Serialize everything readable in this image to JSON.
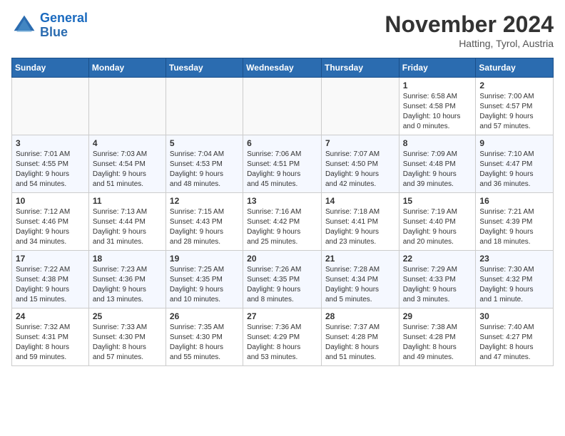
{
  "logo": {
    "text_general": "General",
    "text_blue": "Blue"
  },
  "title": "November 2024",
  "location": "Hatting, Tyrol, Austria",
  "days_of_week": [
    "Sunday",
    "Monday",
    "Tuesday",
    "Wednesday",
    "Thursday",
    "Friday",
    "Saturday"
  ],
  "weeks": [
    [
      {
        "day": "",
        "info": ""
      },
      {
        "day": "",
        "info": ""
      },
      {
        "day": "",
        "info": ""
      },
      {
        "day": "",
        "info": ""
      },
      {
        "day": "",
        "info": ""
      },
      {
        "day": "1",
        "info": "Sunrise: 6:58 AM\nSunset: 4:58 PM\nDaylight: 10 hours\nand 0 minutes."
      },
      {
        "day": "2",
        "info": "Sunrise: 7:00 AM\nSunset: 4:57 PM\nDaylight: 9 hours\nand 57 minutes."
      }
    ],
    [
      {
        "day": "3",
        "info": "Sunrise: 7:01 AM\nSunset: 4:55 PM\nDaylight: 9 hours\nand 54 minutes."
      },
      {
        "day": "4",
        "info": "Sunrise: 7:03 AM\nSunset: 4:54 PM\nDaylight: 9 hours\nand 51 minutes."
      },
      {
        "day": "5",
        "info": "Sunrise: 7:04 AM\nSunset: 4:53 PM\nDaylight: 9 hours\nand 48 minutes."
      },
      {
        "day": "6",
        "info": "Sunrise: 7:06 AM\nSunset: 4:51 PM\nDaylight: 9 hours\nand 45 minutes."
      },
      {
        "day": "7",
        "info": "Sunrise: 7:07 AM\nSunset: 4:50 PM\nDaylight: 9 hours\nand 42 minutes."
      },
      {
        "day": "8",
        "info": "Sunrise: 7:09 AM\nSunset: 4:48 PM\nDaylight: 9 hours\nand 39 minutes."
      },
      {
        "day": "9",
        "info": "Sunrise: 7:10 AM\nSunset: 4:47 PM\nDaylight: 9 hours\nand 36 minutes."
      }
    ],
    [
      {
        "day": "10",
        "info": "Sunrise: 7:12 AM\nSunset: 4:46 PM\nDaylight: 9 hours\nand 34 minutes."
      },
      {
        "day": "11",
        "info": "Sunrise: 7:13 AM\nSunset: 4:44 PM\nDaylight: 9 hours\nand 31 minutes."
      },
      {
        "day": "12",
        "info": "Sunrise: 7:15 AM\nSunset: 4:43 PM\nDaylight: 9 hours\nand 28 minutes."
      },
      {
        "day": "13",
        "info": "Sunrise: 7:16 AM\nSunset: 4:42 PM\nDaylight: 9 hours\nand 25 minutes."
      },
      {
        "day": "14",
        "info": "Sunrise: 7:18 AM\nSunset: 4:41 PM\nDaylight: 9 hours\nand 23 minutes."
      },
      {
        "day": "15",
        "info": "Sunrise: 7:19 AM\nSunset: 4:40 PM\nDaylight: 9 hours\nand 20 minutes."
      },
      {
        "day": "16",
        "info": "Sunrise: 7:21 AM\nSunset: 4:39 PM\nDaylight: 9 hours\nand 18 minutes."
      }
    ],
    [
      {
        "day": "17",
        "info": "Sunrise: 7:22 AM\nSunset: 4:38 PM\nDaylight: 9 hours\nand 15 minutes."
      },
      {
        "day": "18",
        "info": "Sunrise: 7:23 AM\nSunset: 4:36 PM\nDaylight: 9 hours\nand 13 minutes."
      },
      {
        "day": "19",
        "info": "Sunrise: 7:25 AM\nSunset: 4:35 PM\nDaylight: 9 hours\nand 10 minutes."
      },
      {
        "day": "20",
        "info": "Sunrise: 7:26 AM\nSunset: 4:35 PM\nDaylight: 9 hours\nand 8 minutes."
      },
      {
        "day": "21",
        "info": "Sunrise: 7:28 AM\nSunset: 4:34 PM\nDaylight: 9 hours\nand 5 minutes."
      },
      {
        "day": "22",
        "info": "Sunrise: 7:29 AM\nSunset: 4:33 PM\nDaylight: 9 hours\nand 3 minutes."
      },
      {
        "day": "23",
        "info": "Sunrise: 7:30 AM\nSunset: 4:32 PM\nDaylight: 9 hours\nand 1 minute."
      }
    ],
    [
      {
        "day": "24",
        "info": "Sunrise: 7:32 AM\nSunset: 4:31 PM\nDaylight: 8 hours\nand 59 minutes."
      },
      {
        "day": "25",
        "info": "Sunrise: 7:33 AM\nSunset: 4:30 PM\nDaylight: 8 hours\nand 57 minutes."
      },
      {
        "day": "26",
        "info": "Sunrise: 7:35 AM\nSunset: 4:30 PM\nDaylight: 8 hours\nand 55 minutes."
      },
      {
        "day": "27",
        "info": "Sunrise: 7:36 AM\nSunset: 4:29 PM\nDaylight: 8 hours\nand 53 minutes."
      },
      {
        "day": "28",
        "info": "Sunrise: 7:37 AM\nSunset: 4:28 PM\nDaylight: 8 hours\nand 51 minutes."
      },
      {
        "day": "29",
        "info": "Sunrise: 7:38 AM\nSunset: 4:28 PM\nDaylight: 8 hours\nand 49 minutes."
      },
      {
        "day": "30",
        "info": "Sunrise: 7:40 AM\nSunset: 4:27 PM\nDaylight: 8 hours\nand 47 minutes."
      }
    ]
  ]
}
